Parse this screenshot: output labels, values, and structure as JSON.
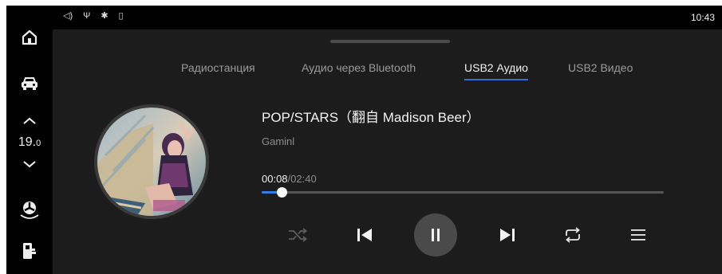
{
  "status": {
    "icons": [
      "volume-icon",
      "usb-icon",
      "bluetooth-icon",
      "phone-icon"
    ],
    "glyphs": [
      "◁)",
      "Ψ",
      "✱",
      "▯"
    ],
    "time": "10:43"
  },
  "sidebar": {
    "items": [
      "home-icon",
      "car-icon",
      "temp-up-icon",
      "temp-down-icon",
      "fan-icon",
      "phone-door-icon"
    ],
    "temperature": "19.",
    "temperature_decimal": "0"
  },
  "tabs": [
    {
      "label": "Радиостанция",
      "active": false
    },
    {
      "label": "Аудио через Bluetooth",
      "active": false
    },
    {
      "label": "USB2 Аудио",
      "active": true
    },
    {
      "label": "USB2 Видео",
      "active": false
    }
  ],
  "track": {
    "title": "POP/STARS（翻自 Madison Beer）",
    "artist": "Gaminl",
    "current_time": "00:08",
    "separator": "/",
    "total_time": "02:40",
    "progress": 0.05
  },
  "controls": [
    "shuffle-icon",
    "previous-icon",
    "pause-icon",
    "next-icon",
    "repeat-icon",
    "playlist-icon"
  ],
  "colors": {
    "accent": "#2f6fd6",
    "panel": "#1c1c1c",
    "background": "#000000"
  }
}
